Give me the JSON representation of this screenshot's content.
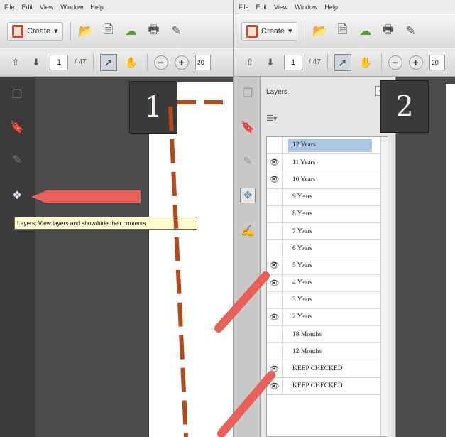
{
  "window1": {
    "menu": [
      "File",
      "Edit",
      "View",
      "Window",
      "Help"
    ],
    "toolbar": {
      "create_label": "Create",
      "create_arrow": "▾"
    },
    "nav": {
      "current_page": "1",
      "page_count": "/ 47",
      "zoom": "20"
    },
    "tooltip": "Layers: View layers and show/hide their contents",
    "step_label": "1"
  },
  "window2": {
    "menu": [
      "File",
      "Edit",
      "View",
      "Window",
      "Help"
    ],
    "toolbar": {
      "create_label": "Create",
      "create_arrow": "▾"
    },
    "nav": {
      "current_page": "1",
      "page_count": "/ 47",
      "zoom": "20"
    },
    "step_label": "2",
    "layers_panel": {
      "title": "Layers",
      "collapse_glyph": "«",
      "options_glyph": "☰▾",
      "items": [
        {
          "label": "12 Years",
          "visible": false,
          "selected": true
        },
        {
          "label": "11 Years",
          "visible": true,
          "selected": false
        },
        {
          "label": "10 Years",
          "visible": true,
          "selected": false
        },
        {
          "label": "9 Years",
          "visible": false,
          "selected": false
        },
        {
          "label": "8 Years",
          "visible": false,
          "selected": false
        },
        {
          "label": "7 Years",
          "visible": false,
          "selected": false
        },
        {
          "label": "6 Years",
          "visible": false,
          "selected": false
        },
        {
          "label": "5 Years",
          "visible": true,
          "selected": false
        },
        {
          "label": "4 Years",
          "visible": true,
          "selected": false
        },
        {
          "label": "3 Years",
          "visible": false,
          "selected": false
        },
        {
          "label": "2 Years",
          "visible": true,
          "selected": false
        },
        {
          "label": "18 Months",
          "visible": false,
          "selected": false
        },
        {
          "label": "12 Months",
          "visible": false,
          "selected": false
        },
        {
          "label": "KEEP CHECKED",
          "visible": true,
          "selected": false
        },
        {
          "label": "KEEP CHECKED",
          "visible": true,
          "selected": false
        }
      ]
    }
  },
  "colors": {
    "annotation_arrow": "#e8605a",
    "dashed_guide": "#b24a1e",
    "selected_layer": "#a9c7e2",
    "dark_rail": "#3b3b3b",
    "tooltip_bg": "#fffbd0"
  },
  "icons": {
    "create": "create-pdf-icon",
    "open": "folder-icon",
    "save": "save-icon",
    "upload": "cloud-upload-icon",
    "print": "printer-icon",
    "edit": "edit-icon",
    "prev": "arrow-up-icon",
    "next": "arrow-down-icon",
    "select": "select-cursor-icon",
    "hand": "hand-icon",
    "zoom_out": "zoom-out-icon",
    "zoom_in": "zoom-in-icon",
    "page_thumbs": "page-thumbnails-icon",
    "bookmarks": "bookmark-icon",
    "attachments": "paperclip-icon",
    "layers": "layers-icon",
    "signatures": "signature-icon",
    "eye": "eye-icon"
  }
}
